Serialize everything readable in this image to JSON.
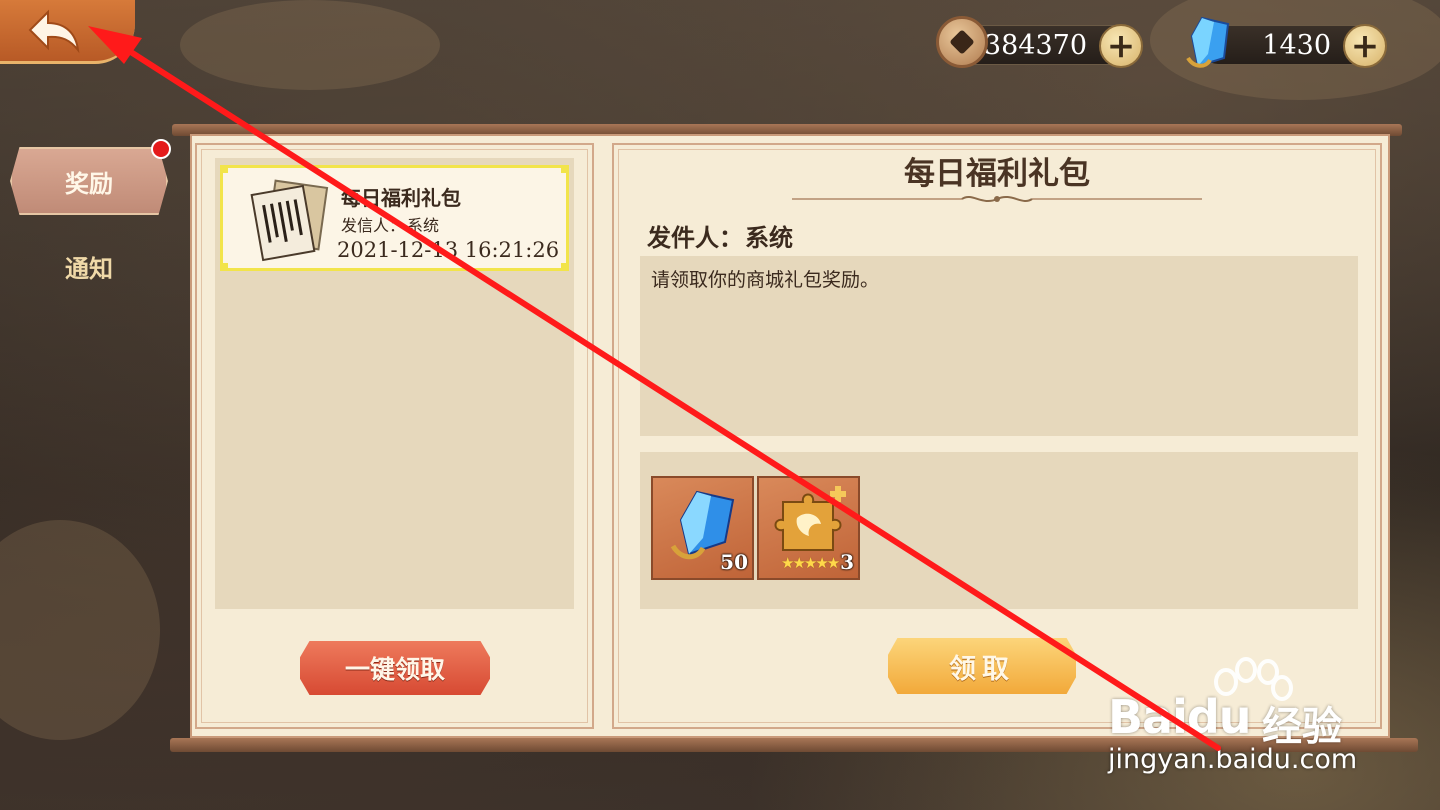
{
  "header": {
    "coins": "384370",
    "crystals": "1430"
  },
  "sidebar": {
    "tabs": [
      {
        "label": "奖励",
        "active": true,
        "has_notification": true
      },
      {
        "label": "通知",
        "active": false
      }
    ]
  },
  "mail_list": {
    "items": [
      {
        "title": "每日福利礼包",
        "sender_label": "发信人：",
        "sender": "系统",
        "date": "2021-12-13 16:21:26",
        "selected": true
      }
    ],
    "claim_all_label": "一键领取"
  },
  "mail_detail": {
    "title": "每日福利礼包",
    "sender_label": "发件人：",
    "sender": "系统",
    "message": "请领取你的商城礼包奖励。",
    "rewards": [
      {
        "icon": "blue-crystal-icon",
        "count": "50"
      },
      {
        "icon": "gold-puzzle-piece-icon",
        "count": "3",
        "stars": 5
      }
    ],
    "claim_label": "领取"
  },
  "annotation": {
    "color": "#ff1a1a"
  },
  "watermark": {
    "brand": "Baidu",
    "brand_cn": "经验",
    "url": "jingyan.baidu.com"
  }
}
